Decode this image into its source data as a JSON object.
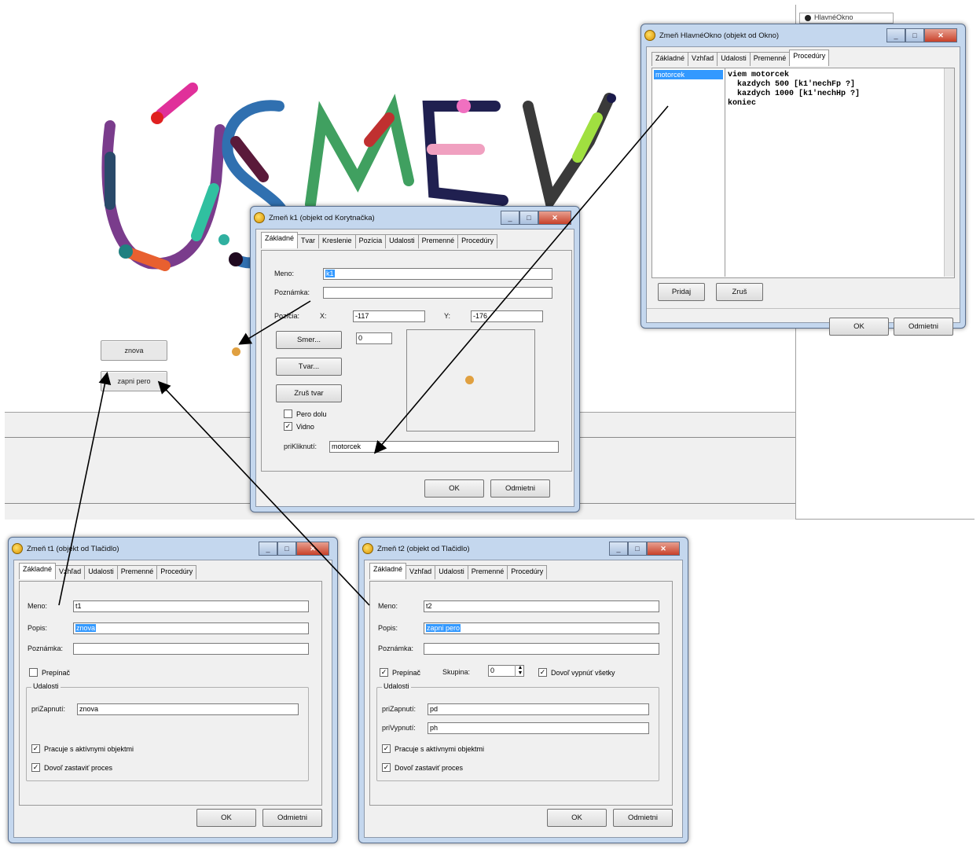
{
  "right_panel": {
    "menu": "...",
    "tree_item": "HlavnéOkno"
  },
  "canvas": {
    "button_znova": "znova",
    "button_zapni_pero": "zapni pero"
  },
  "win_hlavne": {
    "title": "Zmeň HlavnéOkno (objekt od Okno)",
    "tabs": [
      "Základné",
      "Vzhľad",
      "Udalosti",
      "Premenné",
      "Procedúry"
    ],
    "active_tab": 4,
    "procedures": [
      "motorcek"
    ],
    "code": "viem motorcek\n  kazdych 500 [k1'nechFp ?]\n  kazdych 1000 [k1'nechHp ?]\nkoniec",
    "btn_pridaj": "Pridaj",
    "btn_zrus": "Zruš",
    "ok": "OK",
    "cancel": "Odmietni"
  },
  "win_k1": {
    "title": "Zmeň k1 (objekt od Korytnačka)",
    "tabs": [
      "Základné",
      "Tvar",
      "Kreslenie",
      "Pozícia",
      "Udalosti",
      "Premenné",
      "Procedúry"
    ],
    "active_tab": 0,
    "label_meno": "Meno:",
    "meno": "k1",
    "label_poznamka": "Poznámka:",
    "poznamka": "",
    "label_pozicia": "Pozícia:",
    "label_x": "X:",
    "x": "-117",
    "label_y": "Y:",
    "y": "-176",
    "btn_smer": "Smer...",
    "smer": "0",
    "btn_tvar": "Tvar...",
    "btn_zrus_tvar": "Zruš tvar",
    "chk_pero_dolu": "Pero dolu",
    "chk_viditelna": "Vidno",
    "label_priklik": "priKliknutí:",
    "priklik": "motorcek",
    "ok": "OK",
    "cancel": "Odmietni"
  },
  "win_t1": {
    "title": "Zmeň t1 (objekt od Tlačidlo)",
    "tabs": [
      "Základné",
      "Vzhľad",
      "Udalosti",
      "Premenné",
      "Procedúry"
    ],
    "active_tab": 0,
    "label_meno": "Meno:",
    "meno": "t1",
    "label_popis": "Popis:",
    "popis": "znova",
    "label_poznamka": "Poznámka:",
    "chk_prepinac": "Prepínač",
    "group_udalosti": "Udalosti",
    "label_prizapnuti": "priZapnutí:",
    "prizapnuti": "znova",
    "chk_pracuje": "Pracuje s aktívnymi objektmi",
    "chk_dovol": "Dovoľ zastaviť proces",
    "ok": "OK",
    "cancel": "Odmietni"
  },
  "win_t2": {
    "title": "Zmeň t2 (objekt od Tlačidlo)",
    "tabs": [
      "Základné",
      "Vzhľad",
      "Udalosti",
      "Premenné",
      "Procedúry"
    ],
    "active_tab": 0,
    "label_meno": "Meno:",
    "meno": "t2",
    "label_popis": "Popis:",
    "popis": "zapni pero",
    "label_poznamka": "Poznámka:",
    "chk_prepinac": "Prepínač",
    "label_skupina": "Skupina:",
    "skupina": "0",
    "chk_vypnut": "Dovoľ vypnúť všetky",
    "group_udalosti": "Udalosti",
    "label_prizapnuti": "priZapnutí:",
    "prizapnuti": "pd",
    "label_privypnuti": "priVypnutí:",
    "privypnuti": "ph",
    "chk_pracuje": "Pracuje s aktívnymi objektmi",
    "chk_dovol": "Dovoľ zastaviť proces",
    "ok": "OK",
    "cancel": "Odmietni"
  },
  "colors": {
    "selection": "#3399ff",
    "window_frame": "#c4d7ee",
    "turtle": "#e0a040"
  }
}
